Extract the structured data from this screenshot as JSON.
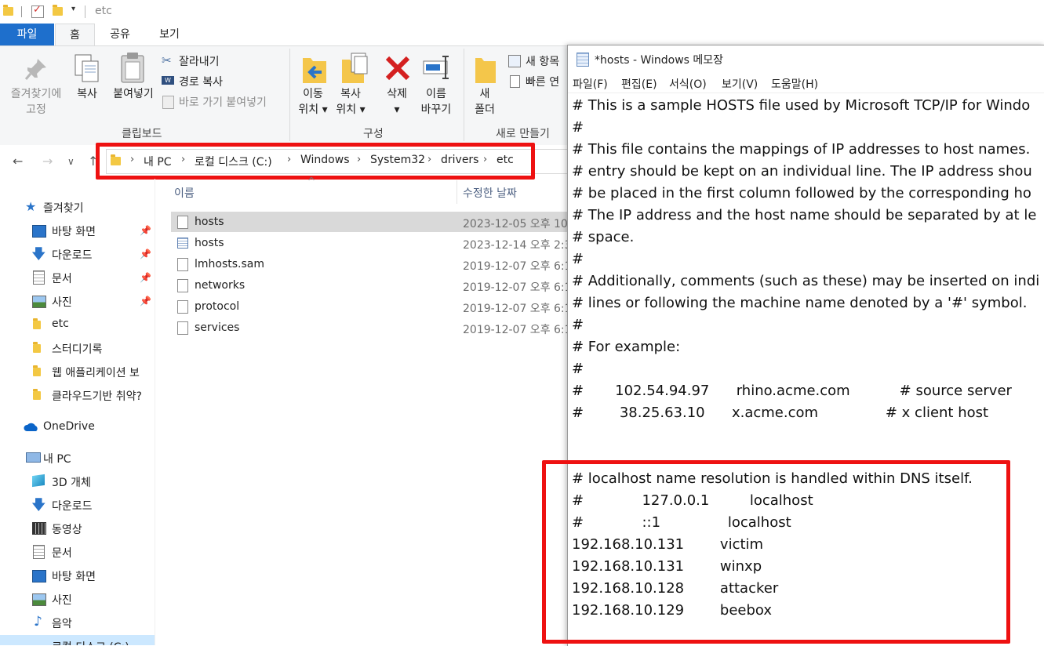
{
  "explorer": {
    "title": "etc",
    "tabs": [
      "파일",
      "홈",
      "공유",
      "보기"
    ],
    "ribbon": {
      "clipboard": {
        "pin": "즐겨찾기에\n고정",
        "copy": "복사",
        "paste": "붙여넣기",
        "cut": "잘라내기",
        "copy_path": "경로 복사",
        "paste_shortcut": "바로 가기 붙여넣기",
        "group": "클립보드"
      },
      "organize": {
        "move": "이동\n위치 ▾",
        "copyto": "복사\n위치 ▾",
        "delete": "삭제\n▾",
        "rename": "이름\n바꾸기",
        "group": "구성"
      },
      "new": {
        "folder": "새\n폴더",
        "new_item": "새 항목",
        "easy_access": "빠른 연",
        "group": "새로 만들기"
      }
    },
    "breadcrumb": [
      "내 PC",
      "로컬 디스크 (C:)",
      "Windows",
      "System32",
      "drivers",
      "etc"
    ],
    "nav": {
      "quick_access": "즐겨찾기",
      "quick_items": [
        "바탕 화면",
        "다운로드",
        "문서",
        "사진",
        "etc",
        "스터디기록",
        "웹 애플리케이션 보",
        "클라우드기반 취약?"
      ],
      "onedrive": "OneDrive",
      "this_pc": "내 PC",
      "pc_items": [
        "3D 개체",
        "다운로드",
        "동영상",
        "문서",
        "바탕 화면",
        "사진",
        "음악",
        "로컬 디스크 (C:)"
      ]
    },
    "columns": {
      "name": "이름",
      "date": "수정한 날짜"
    },
    "files": [
      {
        "name": "hosts",
        "date": "2023-12-05 오후 10"
      },
      {
        "name": "hosts",
        "date": "2023-12-14 오후 2:3"
      },
      {
        "name": "lmhosts.sam",
        "date": "2019-12-07 오후 6:1"
      },
      {
        "name": "networks",
        "date": "2019-12-07 오후 6:1"
      },
      {
        "name": "protocol",
        "date": "2019-12-07 오후 6:1"
      },
      {
        "name": "services",
        "date": "2019-12-07 오후 6:1"
      }
    ]
  },
  "notepad": {
    "title": "*hosts - Windows 메모장",
    "menu": [
      "파일(F)",
      "편집(E)",
      "서식(O)",
      "보기(V)",
      "도움말(H)"
    ],
    "lines": [
      "# This is a sample HOSTS file used by Microsoft TCP/IP for Windo",
      "#",
      "# This file contains the mappings of IP addresses to host names.",
      "# entry should be kept on an individual line. The IP address shou",
      "# be placed in the first column followed by the corresponding ho",
      "# The IP address and the host name should be separated by at le",
      "# space.",
      "#",
      "# Additionally, comments (such as these) may be inserted on indi",
      "# lines or following the machine name denoted by a '#' symbol.",
      "#",
      "# For example:",
      "#",
      "#       102.54.94.97      rhino.acme.com           # source server",
      "#        38.25.63.10      x.acme.com               # x client host",
      "",
      "",
      "# localhost name resolution is handled within DNS itself.",
      "#             127.0.0.1         localhost",
      "#             ::1               localhost",
      "192.168.10.131        victim",
      "192.168.10.131        winxp",
      "192.168.10.128        attacker",
      "192.168.10.129        beebox"
    ]
  }
}
